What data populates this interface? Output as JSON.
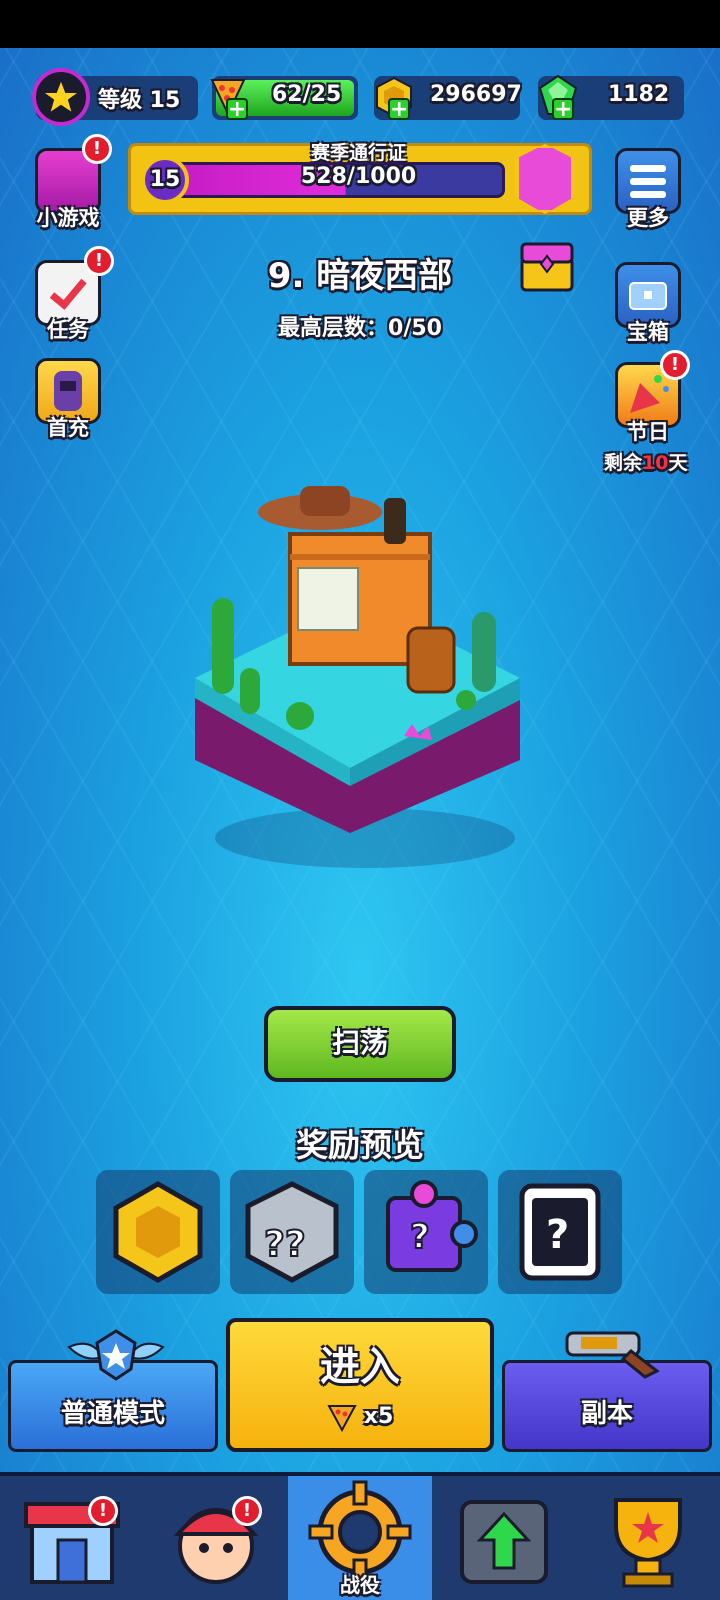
{
  "top": {
    "level_label": "等级 15",
    "energy": "62/25",
    "coins": "296697",
    "gems": "1182",
    "energy_fill": 1.0
  },
  "pass": {
    "title": "赛季通行证",
    "level": "15",
    "progress": "528/1000",
    "progress_fraction": 0.528
  },
  "left_menu": [
    {
      "label": "小游戏",
      "alert": "!"
    },
    {
      "label": "任务",
      "alert": "!"
    },
    {
      "label": "首充"
    }
  ],
  "right_menu": [
    {
      "label": "更多"
    },
    {
      "label": "宝箱"
    },
    {
      "label": "节日",
      "alert": "!"
    }
  ],
  "festival": {
    "prefix": "剩余",
    "days": "10",
    "suffix": "天"
  },
  "stage": {
    "title": "9. 暗夜西部",
    "floor": "最高层数：0/50"
  },
  "sweep_label": "扫荡",
  "reward_title": "奖励预览",
  "rewards": [
    "coin-icon",
    "mystery-dice-icon",
    "puzzle-piece-icon",
    "mystery-card-icon"
  ],
  "modes": {
    "normal": "普通模式",
    "enter": "进入",
    "enter_cost": "x5",
    "dungeon": "副本"
  },
  "nav": {
    "active_label": "战役",
    "shop_alert": "!",
    "hero_alert": "!"
  },
  "colors": {
    "accent_green": "#5fb820",
    "gold": "#f6b20d",
    "alert_red": "#e11d2e",
    "pass_magenta": "#e02ddb"
  }
}
